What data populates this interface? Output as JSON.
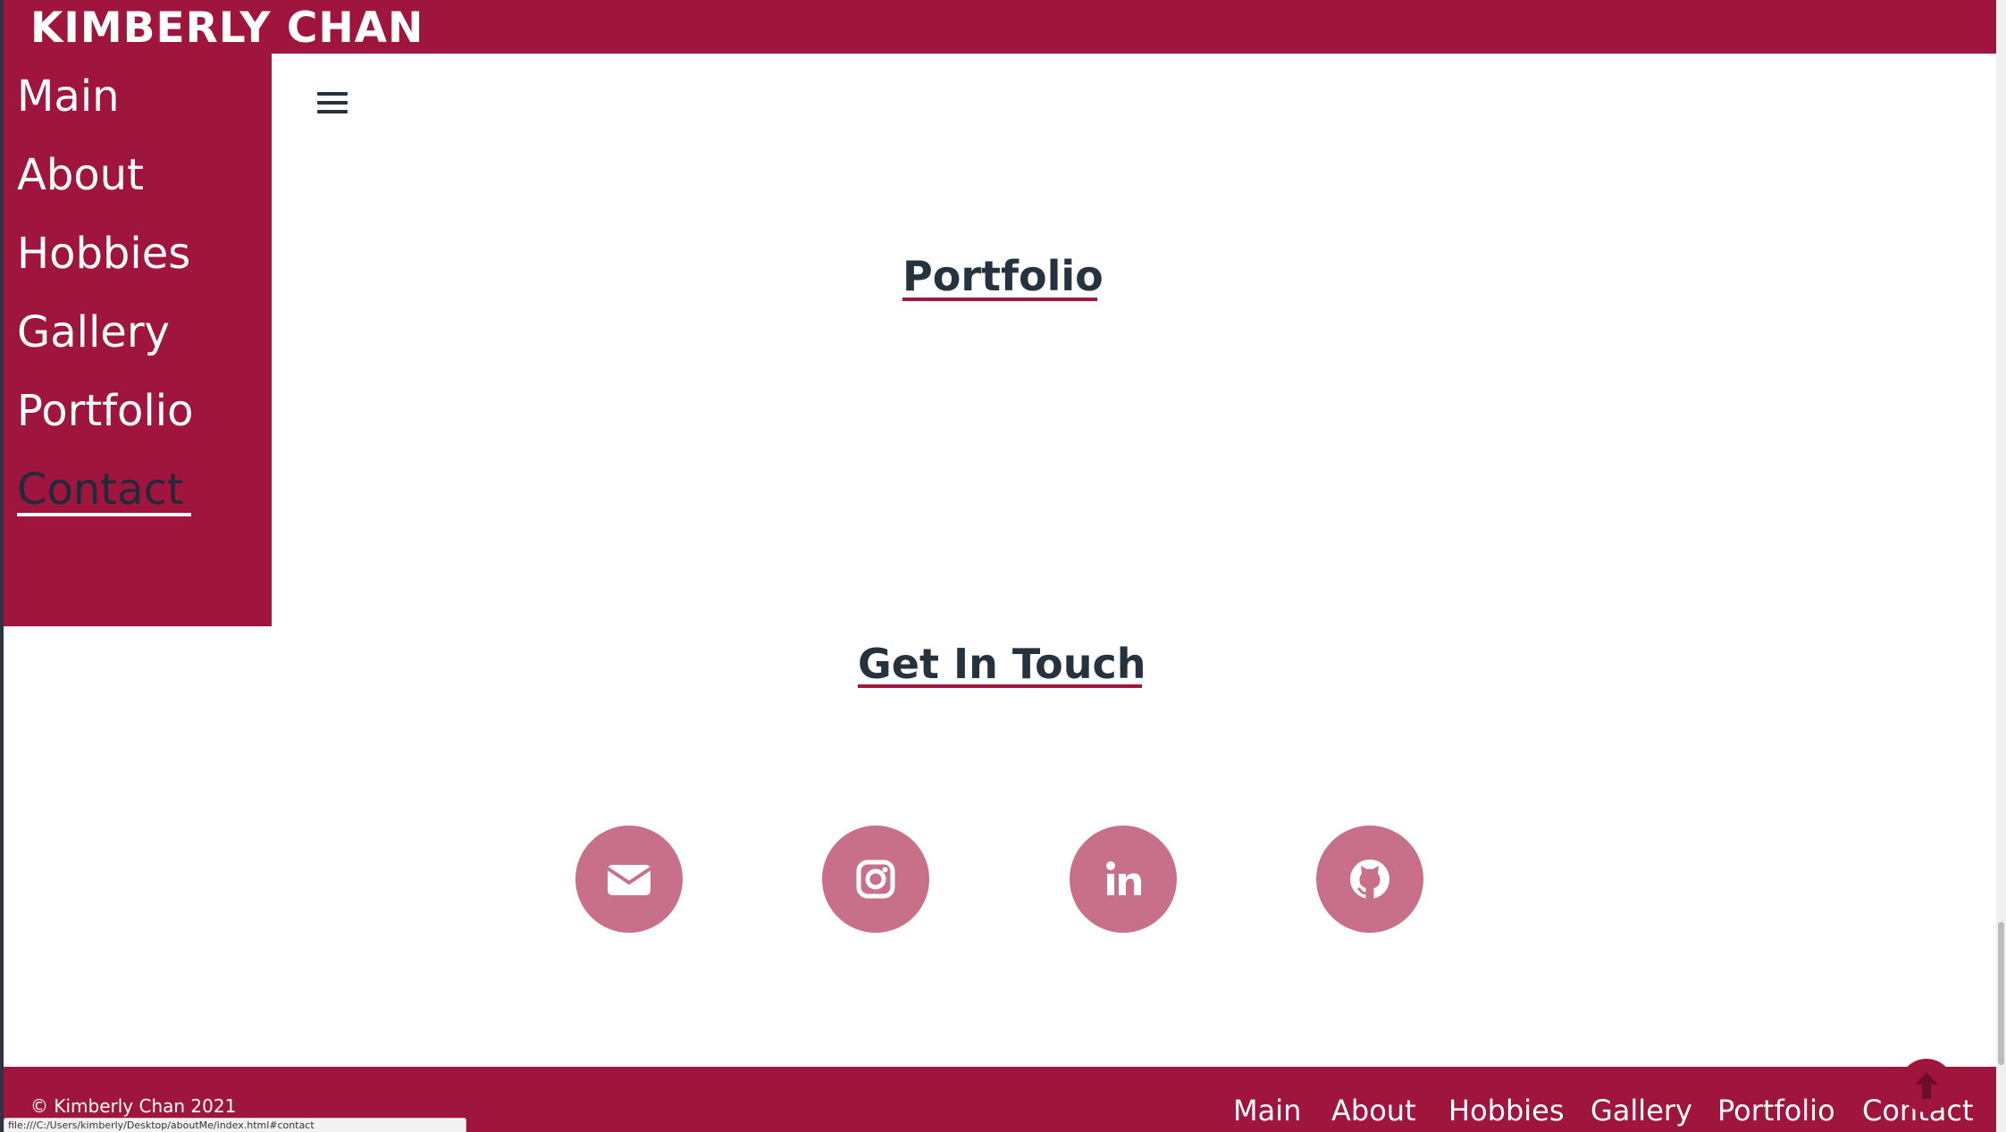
{
  "header": {
    "brand": "KIMBERLY CHAN"
  },
  "sidebar": {
    "items": [
      {
        "label": "Main"
      },
      {
        "label": "About"
      },
      {
        "label": "Hobbies"
      },
      {
        "label": "Gallery"
      },
      {
        "label": "Portfolio"
      },
      {
        "label": "Contact",
        "active": true
      }
    ]
  },
  "main": {
    "menu_icon": "hamburger-menu-icon",
    "portfolio_title": "Portfolio",
    "contact_title": "Get In Touch",
    "social": [
      {
        "name": "email",
        "icon": "envelope-icon"
      },
      {
        "name": "instagram",
        "icon": "instagram-icon"
      },
      {
        "name": "linkedin",
        "icon": "linkedin-icon"
      },
      {
        "name": "github",
        "icon": "github-icon"
      }
    ]
  },
  "footer": {
    "copyright": "© Kimberly Chan 2021",
    "links": [
      "Main",
      "About",
      "Hobbies",
      "Gallery",
      "Portfolio",
      "Contact"
    ],
    "back_to_top_icon": "arrow-up-circle-icon"
  },
  "status_bar": {
    "url": "file:///C:/Users/kimberly/Desktop/aboutMe/index.html#contact"
  },
  "colors": {
    "brand": "#a0153e",
    "social_circle": "#c8708a",
    "heading": "#26333f",
    "white": "#ffffff"
  }
}
